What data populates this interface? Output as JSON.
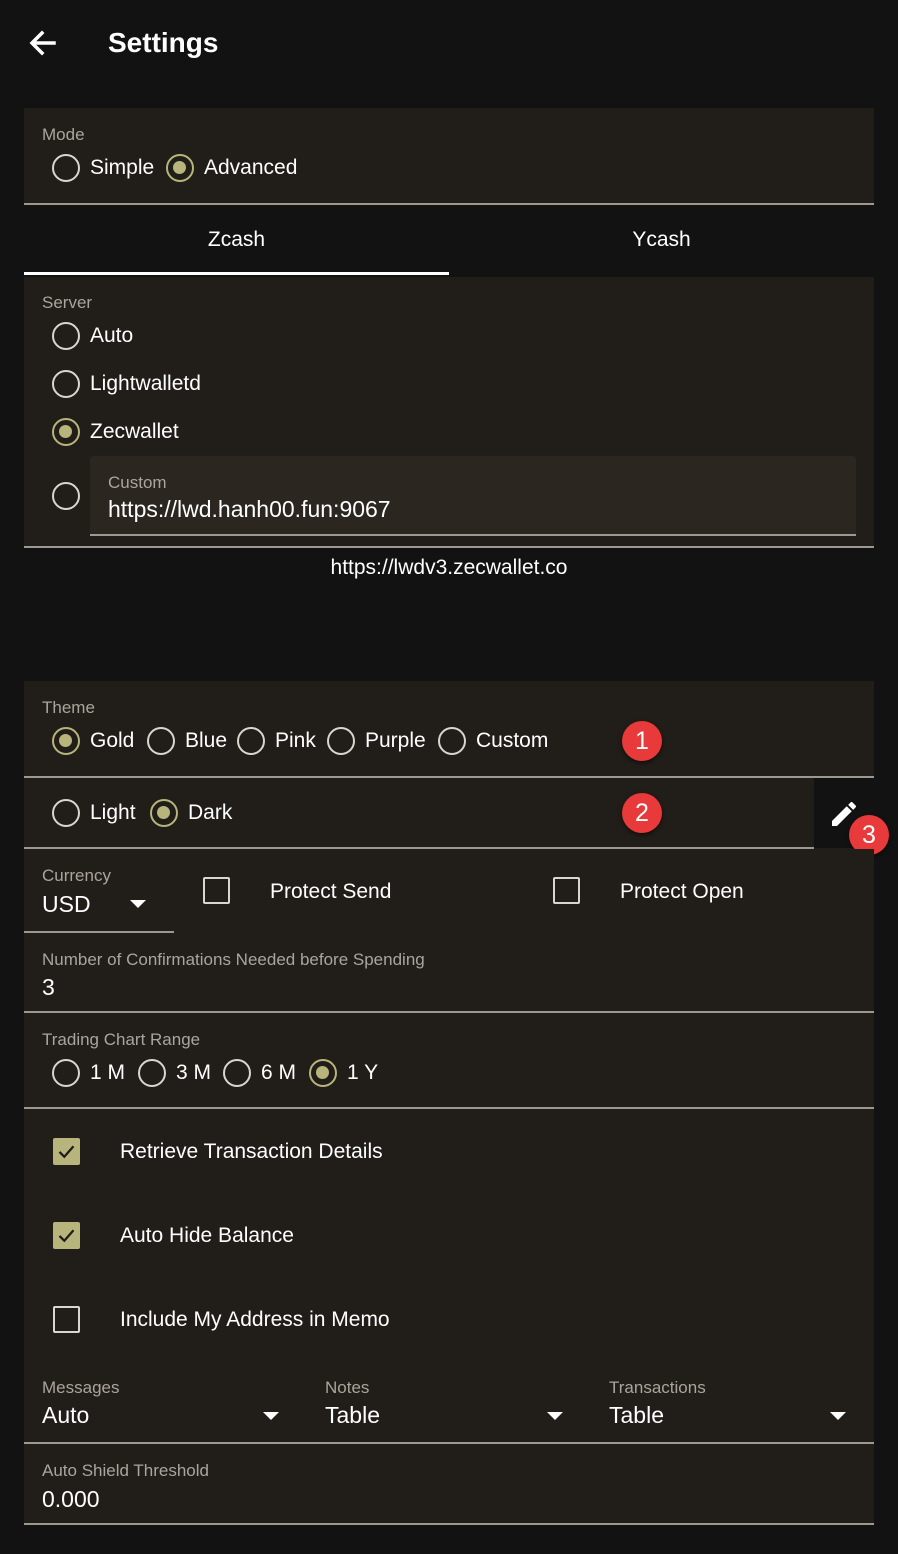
{
  "header": {
    "title": "Settings",
    "back_icon": "arrow-left-icon"
  },
  "mode": {
    "label": "Mode",
    "options": [
      "Simple",
      "Advanced"
    ],
    "selected": "Advanced"
  },
  "coin_tabs": {
    "tabs": [
      "Zcash",
      "Ycash"
    ],
    "active": "Zcash"
  },
  "server": {
    "label": "Server",
    "options": [
      "Auto",
      "Lightwalletd",
      "Zecwallet"
    ],
    "selected": "Zecwallet",
    "custom_label": "Custom",
    "custom_value": "https://lwd.hanh00.fun:9067",
    "current_url": "https://lwdv3.zecwallet.co"
  },
  "theme": {
    "label": "Theme",
    "options": [
      "Gold",
      "Blue",
      "Pink",
      "Purple",
      "Custom"
    ],
    "selected": "Gold",
    "brightness_options": [
      "Light",
      "Dark"
    ],
    "brightness_selected": "Dark",
    "edit_icon": "pencil-icon"
  },
  "annotations": [
    "1",
    "2",
    "3"
  ],
  "currency": {
    "label": "Currency",
    "value": "USD"
  },
  "protect_send": {
    "label": "Protect Send",
    "checked": false
  },
  "protect_open": {
    "label": "Protect Open",
    "checked": false
  },
  "confirmations": {
    "label": "Number of Confirmations Needed before Spending",
    "value": "3"
  },
  "chart_range": {
    "label": "Trading Chart Range",
    "options": [
      "1 M",
      "3 M",
      "6 M",
      "1 Y"
    ],
    "selected": "1 Y"
  },
  "toggles": [
    {
      "label": "Retrieve Transaction Details",
      "checked": true
    },
    {
      "label": "Auto Hide Balance",
      "checked": true
    },
    {
      "label": "Include My Address in Memo",
      "checked": false
    }
  ],
  "views": [
    {
      "label": "Messages",
      "value": "Auto"
    },
    {
      "label": "Notes",
      "value": "Table"
    },
    {
      "label": "Transactions",
      "value": "Table"
    }
  ],
  "auto_shield": {
    "label": "Auto Shield Threshold",
    "value": "0.000"
  },
  "colors": {
    "background": "#121212",
    "panel": "#211d18",
    "accent": "#b7b47c",
    "badge": "#e83a3a"
  }
}
